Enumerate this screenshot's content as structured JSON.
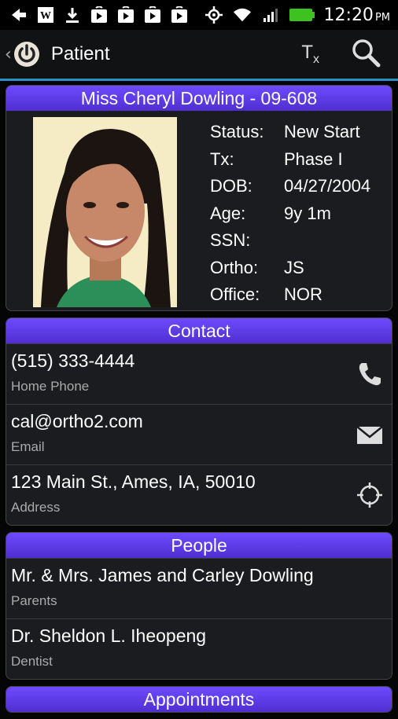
{
  "status_bar": {
    "time": "12:20",
    "ampm": "PM",
    "icons": [
      "back-arrow-icon",
      "w-icon",
      "download-icon",
      "play-store-icon",
      "play-store-icon",
      "play-store-icon",
      "play-store-icon",
      "gps-icon",
      "wifi-icon",
      "signal-icon",
      "battery-icon"
    ]
  },
  "action_bar": {
    "title": "Patient",
    "tx_label": "T",
    "tx_sub": "x"
  },
  "patient": {
    "header": "Miss Cheryl Dowling - 09-608",
    "fields": [
      {
        "label": "Status:",
        "value": "New Start"
      },
      {
        "label": "Tx:",
        "value": "Phase I"
      },
      {
        "label": "DOB:",
        "value": "04/27/2004"
      },
      {
        "label": "Age:",
        "value": "9y 1m"
      },
      {
        "label": "SSN:",
        "value": ""
      },
      {
        "label": "Ortho:",
        "value": "JS"
      },
      {
        "label": "Office:",
        "value": "NOR"
      }
    ]
  },
  "contact": {
    "header": "Contact",
    "rows": [
      {
        "primary": "(515) 333-4444",
        "secondary": "Home Phone",
        "icon": "phone-icon"
      },
      {
        "primary": "cal@ortho2.com",
        "secondary": "Email",
        "icon": "email-icon"
      },
      {
        "primary": "123 Main St., Ames, IA, 50010",
        "secondary": "Address",
        "icon": "location-icon"
      }
    ]
  },
  "people": {
    "header": "People",
    "rows": [
      {
        "primary": "Mr. & Mrs. James and Carley Dowling",
        "secondary": "Parents"
      },
      {
        "primary": "Dr. Sheldon L. Iheopeng",
        "secondary": "Dentist"
      }
    ]
  },
  "appointments": {
    "header": "Appointments"
  },
  "colors": {
    "accent": "#5c3de6",
    "actionbar_line": "#2a8fc4"
  }
}
